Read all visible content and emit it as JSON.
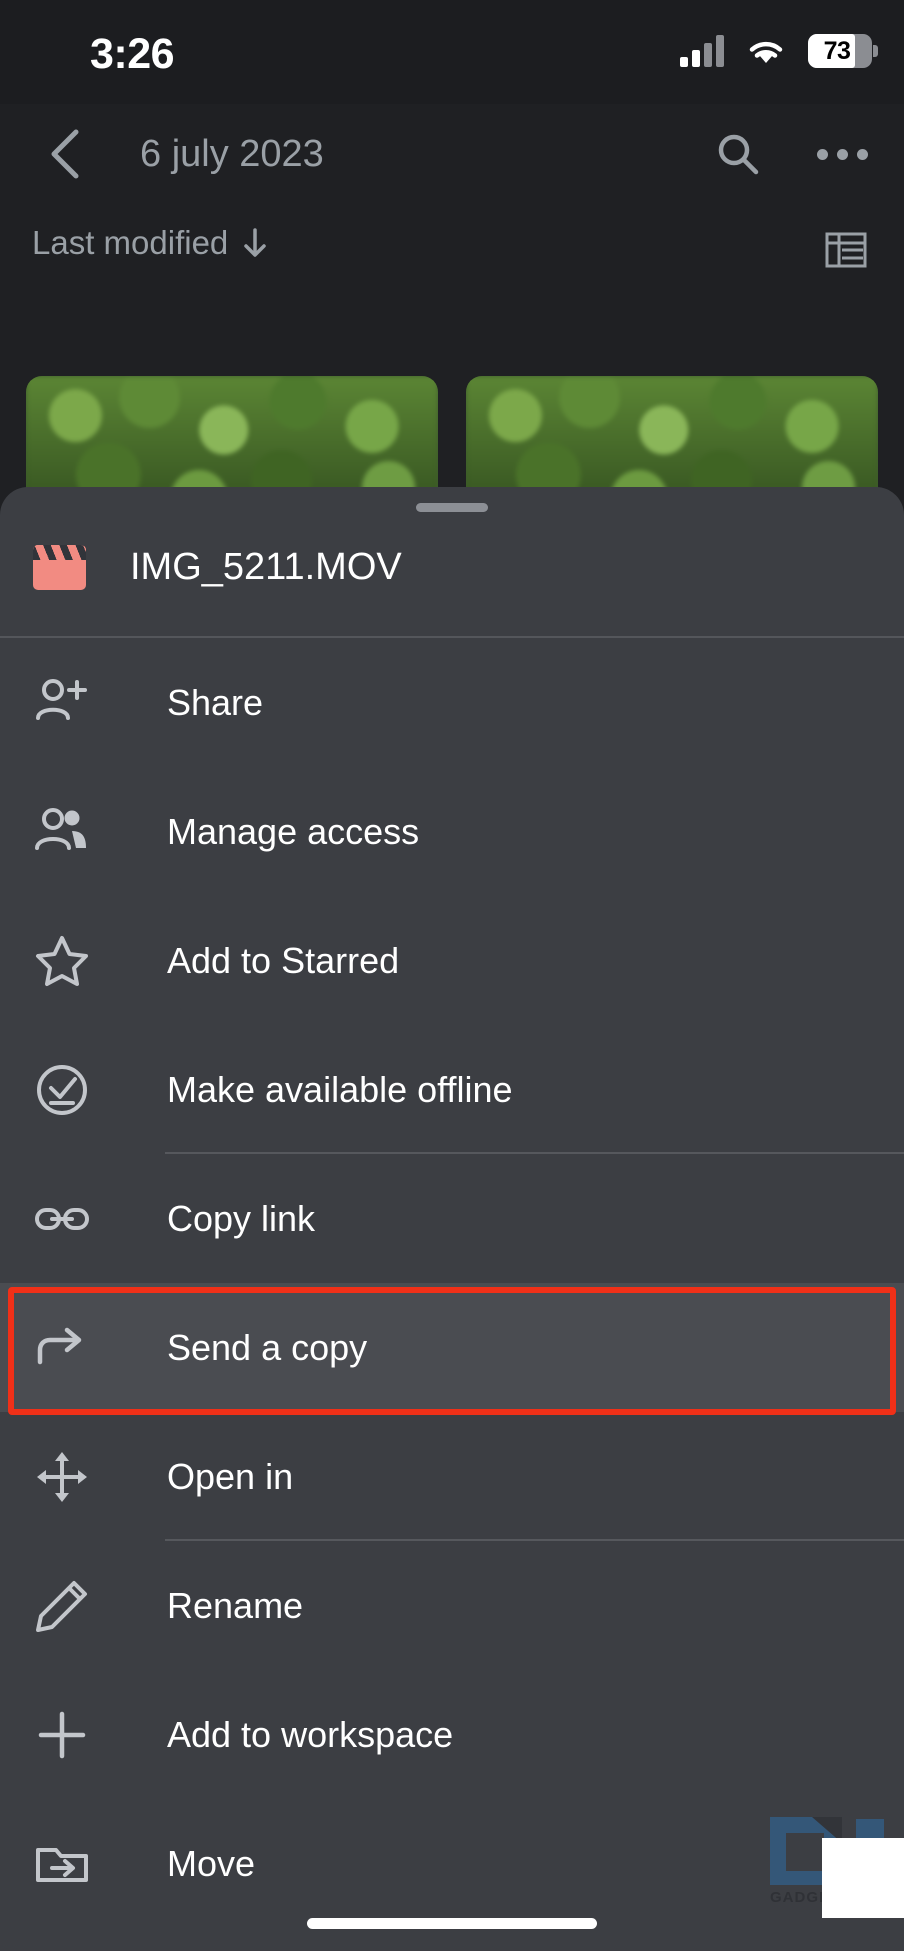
{
  "status_bar": {
    "time": "3:26",
    "battery_percent": "73",
    "icons": [
      "cellular-signal-icon",
      "wifi-icon",
      "battery-icon"
    ]
  },
  "app_bar": {
    "back_icon": "chevron-left-icon",
    "title": "6 july 2023",
    "search_icon": "search-icon",
    "more_icon": "more-options-icon"
  },
  "sort_row": {
    "sort_label": "Last modified",
    "sort_direction_icon": "arrow-down-icon",
    "view_toggle_icon": "list-view-icon"
  },
  "sheet": {
    "drag_handle": "drag-handle",
    "file_icon": "video-clapperboard-icon",
    "file_name": "IMG_5211.MOV",
    "menu_items": [
      {
        "icon": "person-add-icon",
        "label": "Share",
        "divided": false,
        "highlighted": false
      },
      {
        "icon": "people-icon",
        "label": "Manage access",
        "divided": false,
        "highlighted": false
      },
      {
        "icon": "star-outline-icon",
        "label": "Add to Starred",
        "divided": false,
        "highlighted": false
      },
      {
        "icon": "offline-check-circle-icon",
        "label": "Make available offline",
        "divided": true,
        "highlighted": false
      },
      {
        "icon": "link-icon",
        "label": "Copy link",
        "divided": false,
        "highlighted": false
      },
      {
        "icon": "send-arrow-icon",
        "label": "Send a copy",
        "divided": false,
        "highlighted": true
      },
      {
        "icon": "open-in-move-icon",
        "label": "Open in",
        "divided": true,
        "highlighted": false
      },
      {
        "icon": "pencil-icon",
        "label": "Rename",
        "divided": false,
        "highlighted": false
      },
      {
        "icon": "plus-icon",
        "label": "Add to workspace",
        "divided": false,
        "highlighted": false
      },
      {
        "icon": "folder-move-icon",
        "label": "Move",
        "divided": false,
        "highlighted": false
      }
    ]
  },
  "highlight": {
    "target_label": "Send a copy",
    "color": "#f03018"
  },
  "watermark": {
    "text": "GADGETS"
  },
  "colors": {
    "page_background": "#1f2023",
    "status_background": "#1c1d20",
    "sheet_background": "#3c3e43",
    "highlighted_row": "#4a4c51",
    "text_primary": "#ffffff",
    "text_secondary": "#9aa0a6",
    "file_icon": "#f28b82",
    "accent_red": "#f03018"
  }
}
